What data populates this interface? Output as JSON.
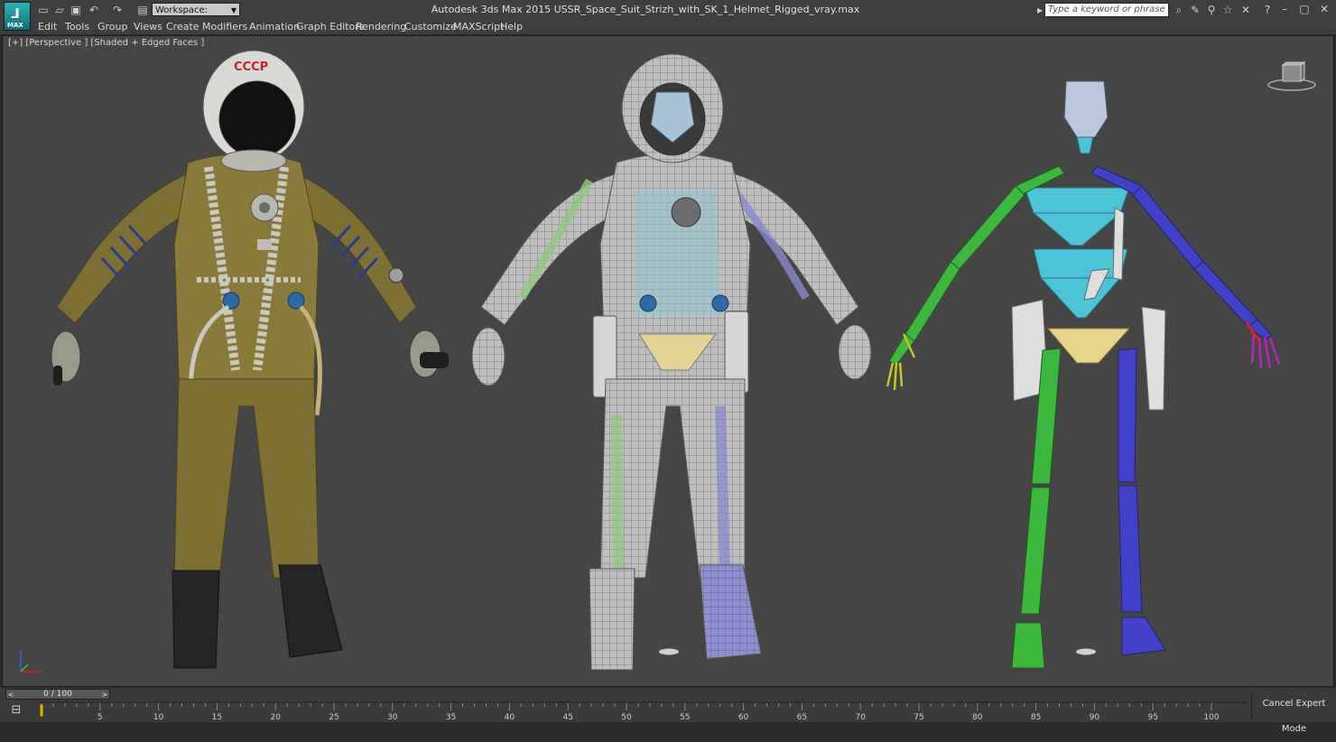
{
  "app": {
    "icon_label": "MAX",
    "title": "Autodesk 3ds Max  2015     USSR_Space_Suit_Strizh_with_SK_1_Helmet_Rigged_vray.max"
  },
  "workspace": {
    "label": "Workspace: Default"
  },
  "search": {
    "placeholder": "Type a keyword or phrase"
  },
  "menu": [
    "Edit",
    "Tools",
    "Group",
    "Views",
    "Create",
    "Modifiers",
    "Animation",
    "Graph Editors",
    "Rendering",
    "Customize",
    "MAXScript",
    "Help"
  ],
  "viewport": {
    "label": "[+] [Perspective ] [Shaded + Edged Faces ]",
    "helmet_text": "СССР"
  },
  "timeline": {
    "frame_readout": "0 / 100",
    "ticks": [
      "5",
      "10",
      "15",
      "20",
      "25",
      "30",
      "35",
      "40",
      "45",
      "50",
      "55",
      "60",
      "65",
      "70",
      "75",
      "80",
      "85",
      "90",
      "95",
      "100"
    ],
    "prev": "<",
    "next": ">"
  },
  "cancel_expert_label": "Cancel Expert Mode",
  "colors": {
    "viewport_bg": "#454545",
    "suit_olive": "#8a7a3a",
    "bone_green": "#3cb83c",
    "bone_blue": "#4040c8",
    "bone_cyan": "#4cc4d8",
    "pelvis": "#e8d48a"
  }
}
